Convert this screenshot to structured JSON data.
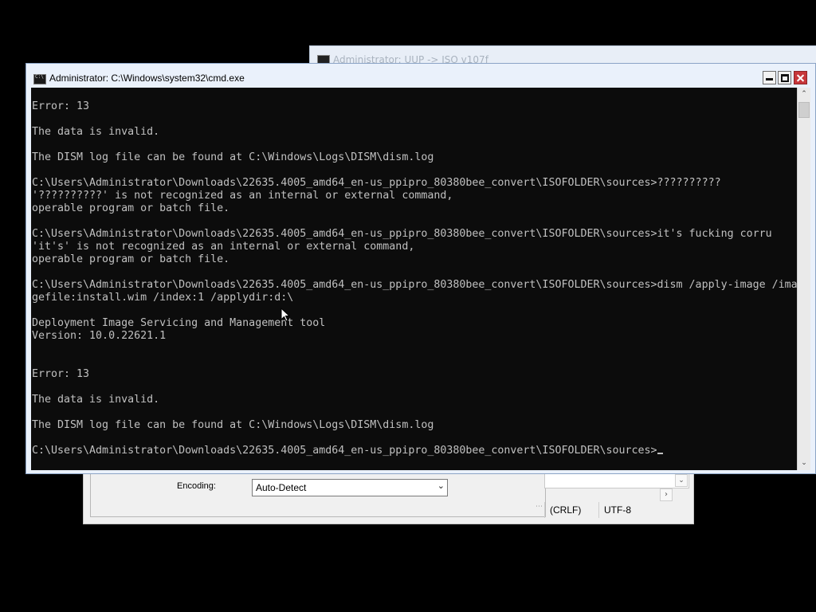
{
  "background_window": {
    "title": "Administrator: UUP -> ISO v107f"
  },
  "notepad": {
    "encoding_label": "Encoding:",
    "encoding_value": "Auto-Detect",
    "status_eol": "(CRLF)",
    "status_encoding": "UTF-8"
  },
  "cmd": {
    "title": "Administrator: C:\\Windows\\system32\\cmd.exe",
    "console_text": "\nError: 13\n\nThe data is invalid.\n\nThe DISM log file can be found at C:\\Windows\\Logs\\DISM\\dism.log\n\nC:\\Users\\Administrator\\Downloads\\22635.4005_amd64_en-us_ppipro_80380bee_convert\\ISOFOLDER\\sources>??????????\n'??????????' is not recognized as an internal or external command,\noperable program or batch file.\n\nC:\\Users\\Administrator\\Downloads\\22635.4005_amd64_en-us_ppipro_80380bee_convert\\ISOFOLDER\\sources>it's fucking corru\n'it's' is not recognized as an internal or external command,\noperable program or batch file.\n\nC:\\Users\\Administrator\\Downloads\\22635.4005_amd64_en-us_ppipro_80380bee_convert\\ISOFOLDER\\sources>dism /apply-image /ima\ngefile:install.wim /index:1 /applydir:d:\\\n\nDeployment Image Servicing and Management tool\nVersion: 10.0.22621.1\n\n\nError: 13\n\nThe data is invalid.\n\nThe DISM log file can be found at C:\\Windows\\Logs\\DISM\\dism.log\n\nC:\\Users\\Administrator\\Downloads\\22635.4005_amd64_en-us_ppipro_80380bee_convert\\ISOFOLDER\\sources>"
  },
  "colors": {
    "console_background": "#0c0c0c",
    "console_text": "#c0c0c0",
    "titlebar": "#eaf1fb",
    "close_button": "#c7373a"
  },
  "icons": {
    "app": "cmd-icon",
    "minimize": "minimize-icon",
    "maximize": "maximize-icon",
    "close": "close-icon",
    "pointer": "mouse-pointer-icon"
  }
}
